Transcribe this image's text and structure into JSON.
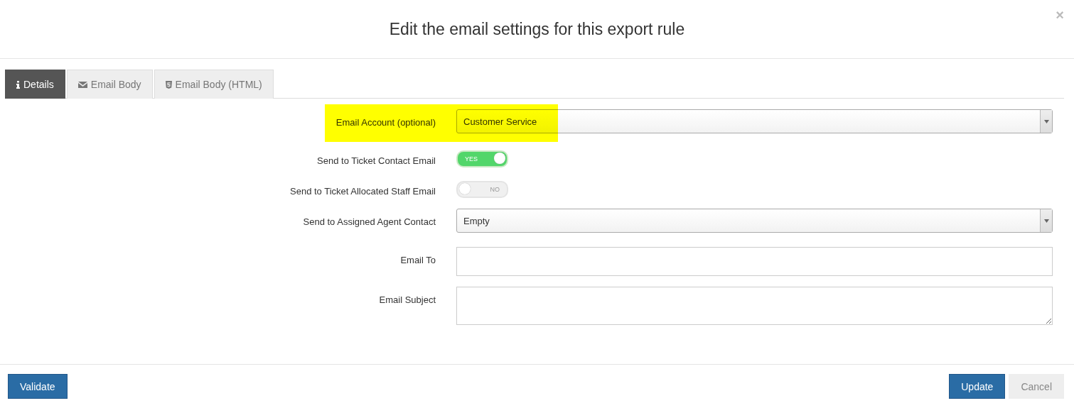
{
  "dialog": {
    "title": "Edit the email settings for this export rule",
    "close": "×"
  },
  "tabs": [
    {
      "label": "Details",
      "selected": true
    },
    {
      "label": "Email Body",
      "selected": false
    },
    {
      "label": "Email Body (HTML)",
      "selected": false
    }
  ],
  "fields": [
    {
      "kind": "select",
      "label": "Email Account (optional)",
      "value": "Customer Service",
      "highlighted": true
    },
    {
      "kind": "toggle",
      "label": "Send to Ticket Contact Email",
      "on": true,
      "text": "YES"
    },
    {
      "kind": "toggle",
      "label": "Send to Ticket Allocated Staff Email",
      "on": false,
      "text": "NO"
    },
    {
      "kind": "select",
      "label": "Send to Assigned Agent Contact",
      "value": "Empty",
      "highlighted": false
    },
    {
      "kind": "text",
      "label": "Email To"
    },
    {
      "kind": "textarea",
      "label": "Email Subject"
    }
  ],
  "footer": {
    "left_buttons": [
      {
        "label": "Validate",
        "kind": "primary"
      }
    ],
    "right_buttons": [
      {
        "label": "Update",
        "kind": "primary"
      },
      {
        "label": "Cancel",
        "kind": "default"
      }
    ]
  }
}
